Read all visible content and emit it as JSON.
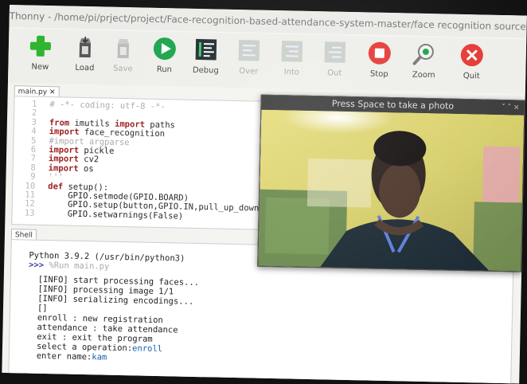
{
  "window": {
    "title": "Thonny  -  /home/pi/prject/project/Face-recognition-based-attendance-system-master/face recognition source code"
  },
  "toolbar": [
    {
      "id": "new",
      "label": "New",
      "icon": "plus-icon",
      "enabled": true
    },
    {
      "id": "load",
      "label": "Load",
      "icon": "folder-icon",
      "enabled": true
    },
    {
      "id": "save",
      "label": "Save",
      "icon": "save-icon",
      "enabled": false
    },
    {
      "id": "run",
      "label": "Run",
      "icon": "play-icon",
      "enabled": true
    },
    {
      "id": "debug",
      "label": "Debug",
      "icon": "debug-icon",
      "enabled": true
    },
    {
      "id": "over",
      "label": "Over",
      "icon": "step-over-icon",
      "enabled": false
    },
    {
      "id": "into",
      "label": "Into",
      "icon": "step-into-icon",
      "enabled": false
    },
    {
      "id": "out",
      "label": "Out",
      "icon": "step-out-icon",
      "enabled": false
    },
    {
      "id": "stop",
      "label": "Stop",
      "icon": "stop-icon",
      "enabled": true
    },
    {
      "id": "zoom",
      "label": "Zoom",
      "icon": "zoom-icon",
      "enabled": true
    },
    {
      "id": "quit",
      "label": "Quit",
      "icon": "close-icon",
      "enabled": true
    }
  ],
  "editor": {
    "tab_label": "main.py",
    "line_numbers": [
      "1",
      "2",
      "3",
      "4",
      "5",
      "6",
      "7",
      "8",
      "9",
      "10",
      "11",
      "12",
      "13"
    ],
    "lines": [
      "# -*- coding: utf-8 -*-",
      "",
      "from imutils import paths",
      "import face_recognition",
      "#import argparse",
      "import pickle",
      "import cv2",
      "import os",
      "'''",
      "def setup():",
      "    GPIO.setmode(GPIO.BOARD)",
      "    GPIO.setup(button,GPIO.IN,pull_up_down = G",
      "    GPIO.setwarnings(False)"
    ]
  },
  "shell": {
    "tab_label": "Shell",
    "version_line": "Python 3.9.2 (/usr/bin/python3)",
    "prompt": ">>>",
    "command": "%Run main.py",
    "output": [
      "[INFO] start processing faces...",
      "[INFO] processing image 1/1",
      "[INFO] serializing encodings...",
      "[]",
      "enroll : new registration",
      "attendance : take attendance",
      "exit : exit the program",
      "select a operation:"
    ],
    "operation_input": "enroll",
    "name_prompt": "enter name:",
    "name_input": "kam"
  },
  "camera_window": {
    "title": "Press Space to take a photo",
    "controls": "˅  ˄  ×"
  },
  "colors": {
    "new_green": "#2fb52f",
    "run_green": "#19a34a",
    "stop_red": "#e53935",
    "quit_red": "#e53935",
    "keyword": "#9b1c1c",
    "comment": "#aaaaaa"
  }
}
